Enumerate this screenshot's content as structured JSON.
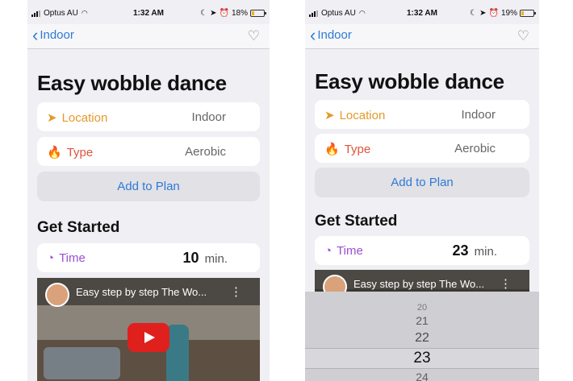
{
  "left": {
    "status": {
      "carrier": "Optus AU",
      "time": "1:32 AM",
      "battery": "18%"
    },
    "nav": {
      "back_label": "Indoor"
    },
    "title": "Easy wobble dance",
    "location": {
      "label": "Location",
      "value": "Indoor"
    },
    "type": {
      "label": "Type",
      "value": "Aerobic"
    },
    "add_button": "Add to Plan",
    "section": "Get Started",
    "time": {
      "label": "Time",
      "value": "10",
      "unit": "min."
    },
    "video": {
      "title": "Easy step by step The Wo..."
    }
  },
  "right": {
    "status": {
      "carrier": "Optus AU",
      "time": "1:32 AM",
      "battery": "19%"
    },
    "nav": {
      "back_label": "Indoor"
    },
    "title": "Easy wobble dance",
    "location": {
      "label": "Location",
      "value": "Indoor"
    },
    "type": {
      "label": "Type",
      "value": "Aerobic"
    },
    "add_button": "Add to Plan",
    "section": "Get Started",
    "time": {
      "label": "Time",
      "value": "23",
      "unit": "min."
    },
    "video": {
      "title": "Easy step by step The Wo..."
    },
    "picker": {
      "values": [
        "20",
        "21",
        "22",
        "23",
        "24"
      ],
      "selected": "23"
    }
  },
  "colors": {
    "accent": "#2f7ad6",
    "location": "#e39a2a",
    "type": "#e0533d",
    "time": "#9b4fd1",
    "battery": "#f0b400"
  }
}
